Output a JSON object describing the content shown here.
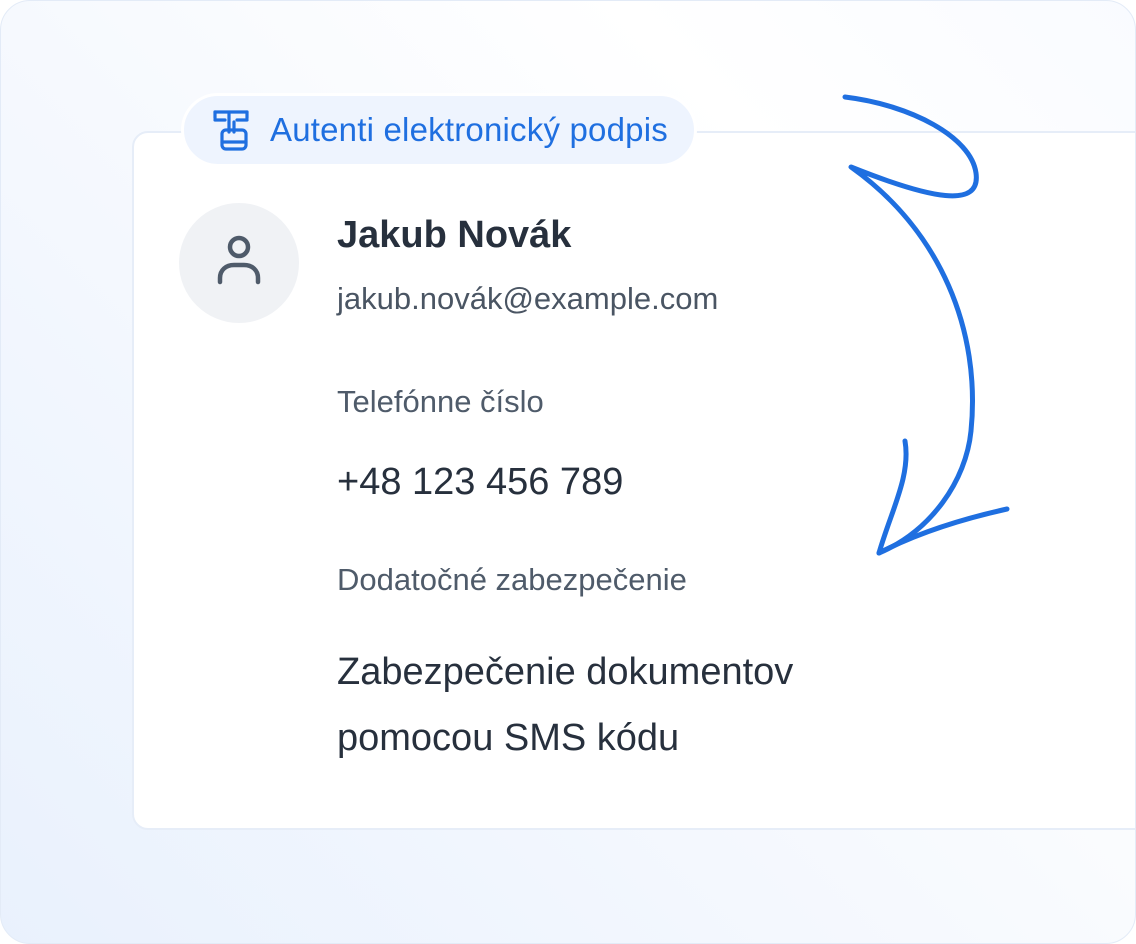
{
  "badge": {
    "label": "Autenti elektronický podpis",
    "icon": "signature-hand-icon"
  },
  "profile": {
    "avatar_icon": "user-icon",
    "name": "Jakub Novák",
    "email": "jakub.novák@example.com"
  },
  "phone": {
    "label": "Telefónne číslo",
    "value": "+48 123 456 789"
  },
  "security": {
    "label": "Dodatočné zabezpečenie",
    "value": "Zabezpečenie dokumentov pomocou SMS kódu"
  },
  "colors": {
    "accent": "#1f6fe0",
    "text": "#27303d",
    "muted": "#4f5b6a"
  }
}
